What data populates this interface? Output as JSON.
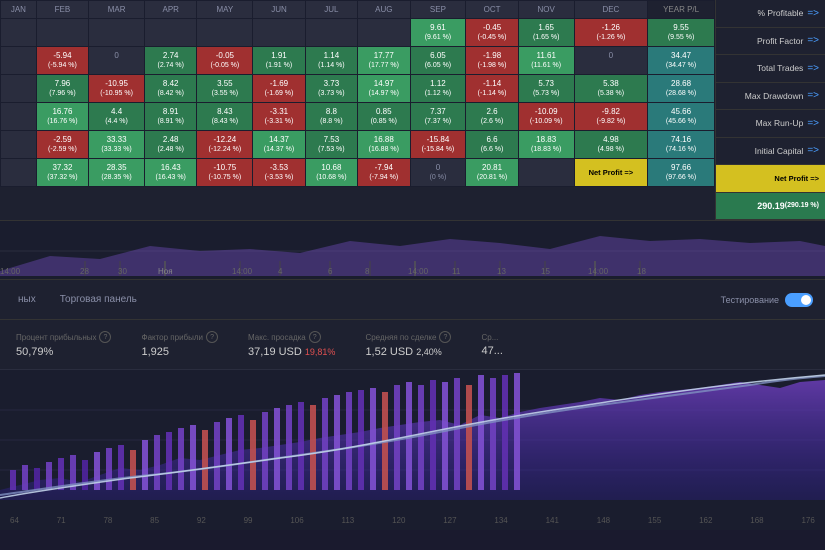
{
  "heatmap": {
    "months": [
      "JAN",
      "FEB",
      "MAR",
      "APR",
      "MAY",
      "JUN",
      "JUL",
      "AUG",
      "SEP",
      "OCT",
      "NOV",
      "DEC",
      "YEAR P/L"
    ],
    "rows": [
      {
        "cells": [
          {
            "v": "",
            "p": "",
            "color": "dark"
          },
          {
            "v": "-5.94",
            "p": "-5.94 %",
            "color": "red"
          },
          {
            "v": "0",
            "p": "0",
            "color": "dark"
          },
          {
            "v": "2.74",
            "p": "2.74 %",
            "color": "green"
          },
          {
            "v": "-0.05",
            "p": "-0.05 %",
            "color": "red"
          },
          {
            "v": "1.91",
            "p": "1.91 %",
            "color": "green"
          },
          {
            "v": "1.14",
            "p": "1.14 %",
            "color": "green"
          },
          {
            "v": "17.77",
            "p": "17.77 %",
            "color": "green-light"
          },
          {
            "v": "6.05",
            "p": "6.05 %",
            "color": "green"
          },
          {
            "v": "-1.98",
            "p": "-1.98 %",
            "color": "red"
          },
          {
            "v": "11.61",
            "p": "11.61 %",
            "color": "green-light"
          },
          {
            "v": "0",
            "p": "0",
            "color": "dark"
          },
          {
            "v": "34.47",
            "p": "34.47 %",
            "color": "teal"
          }
        ]
      },
      {
        "cells": [
          {
            "v": "",
            "p": "",
            "color": "dark"
          },
          {
            "v": "7.96",
            "p": "7.96 %",
            "color": "green"
          },
          {
            "v": "-10.95",
            "p": "-10.95 %",
            "color": "red"
          },
          {
            "v": "8.42",
            "p": "8.42 %",
            "color": "green"
          },
          {
            "v": "3.55",
            "p": "3.55 %",
            "color": "green"
          },
          {
            "v": "-1.69",
            "p": "-1.69 %",
            "color": "red"
          },
          {
            "v": "3.73",
            "p": "3.73 %",
            "color": "green"
          },
          {
            "v": "14.97",
            "p": "14.97 %",
            "color": "green-light"
          },
          {
            "v": "1.12",
            "p": "1.12 %",
            "color": "green"
          },
          {
            "v": "-1.14",
            "p": "-1.14 %",
            "color": "red"
          },
          {
            "v": "5.73",
            "p": "5.73 %",
            "color": "green"
          },
          {
            "v": "5.38",
            "p": "5.38 %",
            "color": "green"
          },
          {
            "v": "28.68",
            "p": "28.68 %",
            "color": "teal"
          }
        ]
      },
      {
        "cells": [
          {
            "v": "",
            "p": "",
            "color": "dark"
          },
          {
            "v": "16.76",
            "p": "16.76 %",
            "color": "green-light"
          },
          {
            "v": "4.4",
            "p": "4.4 %",
            "color": "green"
          },
          {
            "v": "8.91",
            "p": "8.91 %",
            "color": "green"
          },
          {
            "v": "8.43",
            "p": "8.43 %",
            "color": "green"
          },
          {
            "v": "-3.31",
            "p": "-3.31 %",
            "color": "red"
          },
          {
            "v": "8.8",
            "p": "8.8 %",
            "color": "green"
          },
          {
            "v": "0.85",
            "p": "0.85 %",
            "color": "green"
          },
          {
            "v": "7.37",
            "p": "7.37 %",
            "color": "green"
          },
          {
            "v": "2.6",
            "p": "2.6 %",
            "color": "green"
          },
          {
            "v": "-10.09",
            "p": "-10.09 %",
            "color": "red"
          },
          {
            "v": "-9.82",
            "p": "-9.82 %",
            "color": "red"
          },
          {
            "v": "45.66",
            "p": "45.66 %",
            "color": "teal"
          }
        ]
      },
      {
        "cells": [
          {
            "v": "",
            "p": "",
            "color": "dark"
          },
          {
            "v": "-2.59",
            "p": "-2.59 %",
            "color": "red"
          },
          {
            "v": "33.33",
            "p": "33.33 %",
            "color": "green-light"
          },
          {
            "v": "2.48",
            "p": "2.48 %",
            "color": "green"
          },
          {
            "v": "-12.24",
            "p": "-12.24 %",
            "color": "red"
          },
          {
            "v": "14.37",
            "p": "14.37 %",
            "color": "green-light"
          },
          {
            "v": "7.53",
            "p": "7.53 %",
            "color": "green"
          },
          {
            "v": "16.88",
            "p": "16.88 %",
            "color": "green-light"
          },
          {
            "v": "-15.84",
            "p": "-15.84 %",
            "color": "red"
          },
          {
            "v": "6.6",
            "p": "6.6 %",
            "color": "green"
          },
          {
            "v": "18.83",
            "p": "18.83 %",
            "color": "green-light"
          },
          {
            "v": "4.98",
            "p": "4.98 %",
            "color": "green"
          },
          {
            "v": "74.16",
            "p": "74.16 %",
            "color": "teal"
          }
        ]
      },
      {
        "cells": [
          {
            "v": "",
            "p": "",
            "color": "dark"
          },
          {
            "v": "37.32",
            "p": "37.32 %",
            "color": "green-light"
          },
          {
            "v": "28.35",
            "p": "28.35 %",
            "color": "green-light"
          },
          {
            "v": "16.43",
            "p": "16.43 %",
            "color": "green-light"
          },
          {
            "v": "-10.75",
            "p": "-10.75 %",
            "color": "red"
          },
          {
            "v": "-3.53",
            "p": "-3.53 %",
            "color": "red"
          },
          {
            "v": "10.68",
            "p": "10.68 %",
            "color": "green-light"
          },
          {
            "v": "-7.94",
            "p": "-7.94 %",
            "color": "red"
          },
          {
            "v": "0",
            "p": "0 %",
            "color": "dark"
          },
          {
            "v": "20.81",
            "p": "20.81 %",
            "color": "green-light"
          },
          {
            "v": "",
            "p": "",
            "color": "dark"
          },
          {
            "v": "",
            "p": "",
            "color": "dark"
          },
          {
            "v": "97.66",
            "p": "97.66 %",
            "color": "teal"
          }
        ]
      }
    ],
    "top_row": [
      {
        "v": "9.61",
        "p": "(9.61 %)",
        "color": "green"
      },
      {
        "v": "-0.45",
        "p": "(-0.45 %)",
        "color": "red"
      },
      {
        "v": "1.65",
        "p": "(1.65 %)",
        "color": "green"
      },
      {
        "v": "-1.26",
        "p": "(-1.26 %)",
        "color": "red"
      },
      {
        "v": "9.55",
        "p": "(9.55 %)",
        "color": "green"
      }
    ]
  },
  "right_panel": {
    "items": [
      {
        "label": "% Profitable",
        "arrow": "=>"
      },
      {
        "label": "Profit Factor",
        "arrow": "=>"
      },
      {
        "label": "Total Trades",
        "arrow": "=>"
      },
      {
        "label": "Max Drawdown",
        "arrow": "=>"
      },
      {
        "label": "Max Run-Up",
        "arrow": "=>"
      },
      {
        "label": "Initial Capital",
        "arrow": "=>"
      },
      {
        "label": "Net Profit =>",
        "arrow": ""
      }
    ]
  },
  "net_profit": {
    "label": "Net Profit =>",
    "value": "290.19",
    "pct": "(290.19 %)"
  },
  "toolbar": {
    "btn1": "ных",
    "btn2": "Торговая панель",
    "toggle_label": "Тестирование"
  },
  "stats": [
    {
      "label": "Процент прибыльных",
      "value": "50,79%",
      "sub": null
    },
    {
      "label": "Фактор прибыли",
      "value": "1,925",
      "sub": null
    },
    {
      "label": "Макс. просадка",
      "value": "37,19 USD",
      "sub": "19,81%",
      "sub_color": "red"
    },
    {
      "label": "Средняя по сделке",
      "value": "1,52 USD",
      "sub": "2,40%"
    },
    {
      "label": "Ср...",
      "value": "47...",
      "sub": null
    }
  ],
  "timeline": {
    "labels": [
      "14:00",
      "28",
      "30",
      "Ноя",
      "14:00",
      "4",
      "6",
      "8",
      "14:00",
      "11",
      "13",
      "15",
      "14:00",
      "18"
    ]
  },
  "chart_bottom_labels": [
    "64",
    "71",
    "78",
    "85",
    "92",
    "99",
    "106",
    "113",
    "120",
    "127",
    "134",
    "141",
    "148",
    "155",
    "162",
    "168",
    "176"
  ]
}
